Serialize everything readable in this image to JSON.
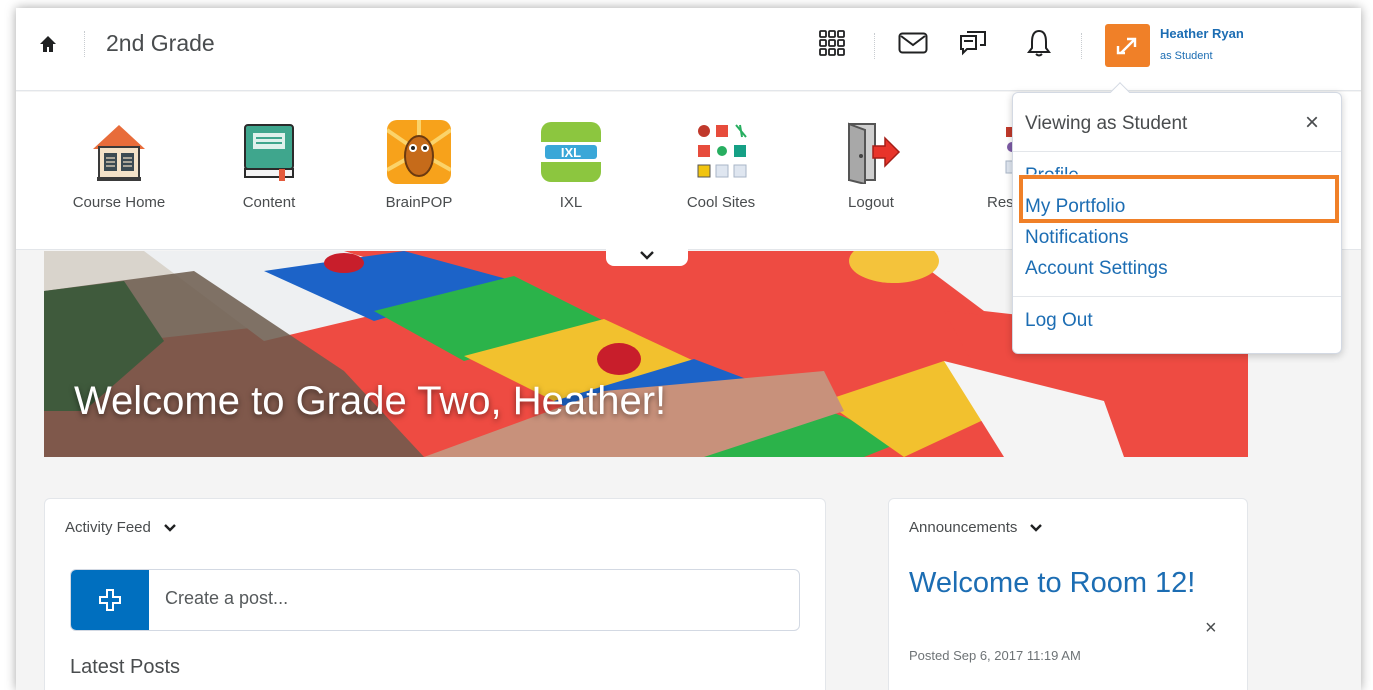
{
  "navbar": {
    "course_title": "2nd Grade",
    "user_name": "Heather Ryan",
    "user_role": "as Student"
  },
  "tools": [
    {
      "label": "Course Home",
      "icon": "house-icon"
    },
    {
      "label": "Content",
      "icon": "book-icon"
    },
    {
      "label": "BrainPOP",
      "icon": "robot-icon"
    },
    {
      "label": "IXL",
      "icon": "ixl-icon"
    },
    {
      "label": "Cool Sites",
      "icon": "sites-grid-icon"
    },
    {
      "label": "Logout",
      "icon": "exit-door-icon"
    },
    {
      "label": "Res",
      "icon": "resources-icon"
    }
  ],
  "banner": {
    "title": "Welcome to Grade Two, Heather!"
  },
  "activity_feed": {
    "title": "Activity Feed",
    "post_placeholder": "Create a post...",
    "latest_title": "Latest Posts"
  },
  "announcements": {
    "title": "Announcements",
    "item_title": "Welcome to Room 12!",
    "close_glyph": "×",
    "posted": "Posted Sep 6, 2017 11:19 AM"
  },
  "dropdown": {
    "heading": "Viewing as Student",
    "close_glyph": "×",
    "items": [
      "Profile",
      "My Portfolio",
      "Notifications",
      "Account Settings"
    ],
    "logout": "Log Out",
    "highlighted_item": "My Portfolio"
  },
  "colors": {
    "link": "#1c6db3",
    "accent_orange": "#f08028",
    "primary_button": "#006fbf"
  }
}
